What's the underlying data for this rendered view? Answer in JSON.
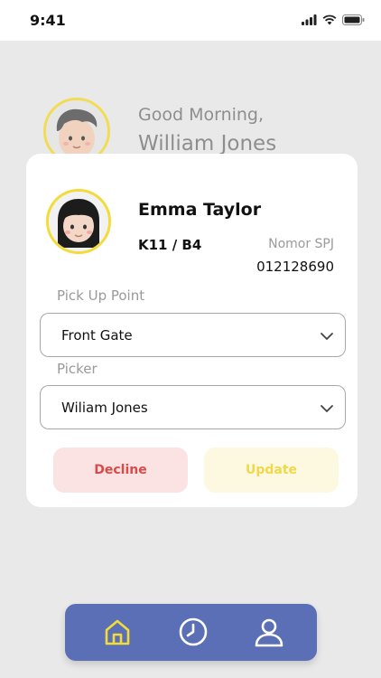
{
  "status_bar": {
    "time": "9:41"
  },
  "greeting": {
    "line1": "Good Morning,",
    "line2": "William Jones"
  },
  "student": {
    "name": "Emma Taylor",
    "class": "K11 / B4",
    "spj_label": "Nomor SPJ",
    "spj_value": "012128690"
  },
  "form": {
    "pickup_label": "Pick Up Point",
    "pickup_value": "Front Gate",
    "picker_label": "Picker",
    "picker_value": "Wiliam Jones"
  },
  "actions": {
    "decline": "Decline",
    "update": "Update"
  },
  "colors": {
    "accent": "#5a6fb6",
    "avatar_ring": "#f3dc3a",
    "decline_text": "#d84b4b",
    "update_text": "#efd84a"
  },
  "icons": {
    "status": [
      "signal-icon",
      "wifi-icon",
      "battery-icon"
    ],
    "nav": [
      "home-icon",
      "clock-icon",
      "profile-icon"
    ]
  }
}
